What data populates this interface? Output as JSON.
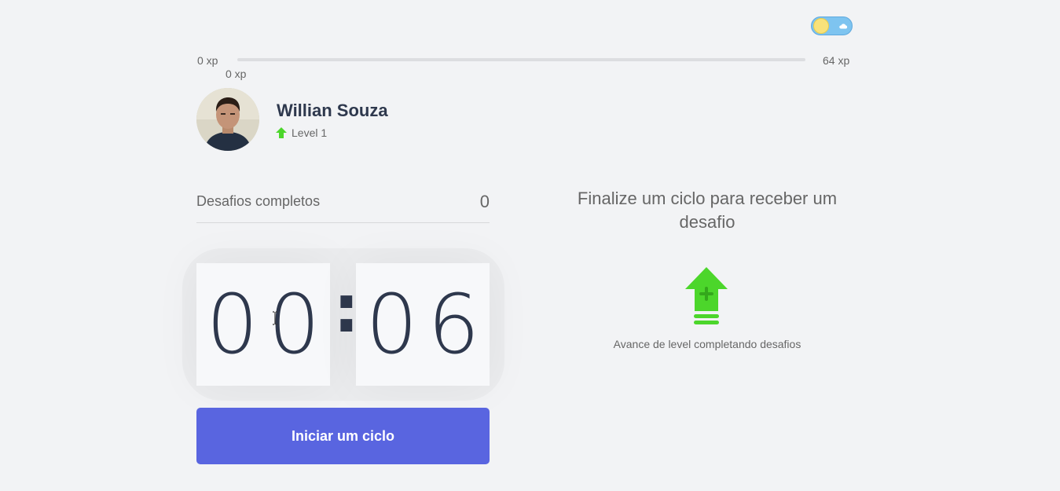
{
  "theme_toggle": {
    "state": "light",
    "icons": [
      "sun-icon",
      "cloud-icon"
    ]
  },
  "experience": {
    "min_label": "0 xp",
    "max_label": "64 xp",
    "current_label": "0 xp",
    "progress": 0
  },
  "profile": {
    "name": "Willian Souza",
    "level_label": "Level 1",
    "level_icon": "level-up-icon"
  },
  "completed_challenges": {
    "label": "Desafios completos",
    "value": "0"
  },
  "countdown": {
    "minute_left": "0",
    "minute_right": "0",
    "separator": ":",
    "second_left": "0",
    "second_right": "6"
  },
  "start_button": {
    "label": "Iniciar um ciclo"
  },
  "challenge_box": {
    "title": "Finalize um ciclo para receber um desafio",
    "hint": "Avance de level completando desafios",
    "icon": "level-up-icon"
  },
  "colors": {
    "background": "#f2f3f5",
    "primary": "#5965e0",
    "green": "#4cd62b",
    "title": "#2e384d",
    "text": "#666666"
  }
}
